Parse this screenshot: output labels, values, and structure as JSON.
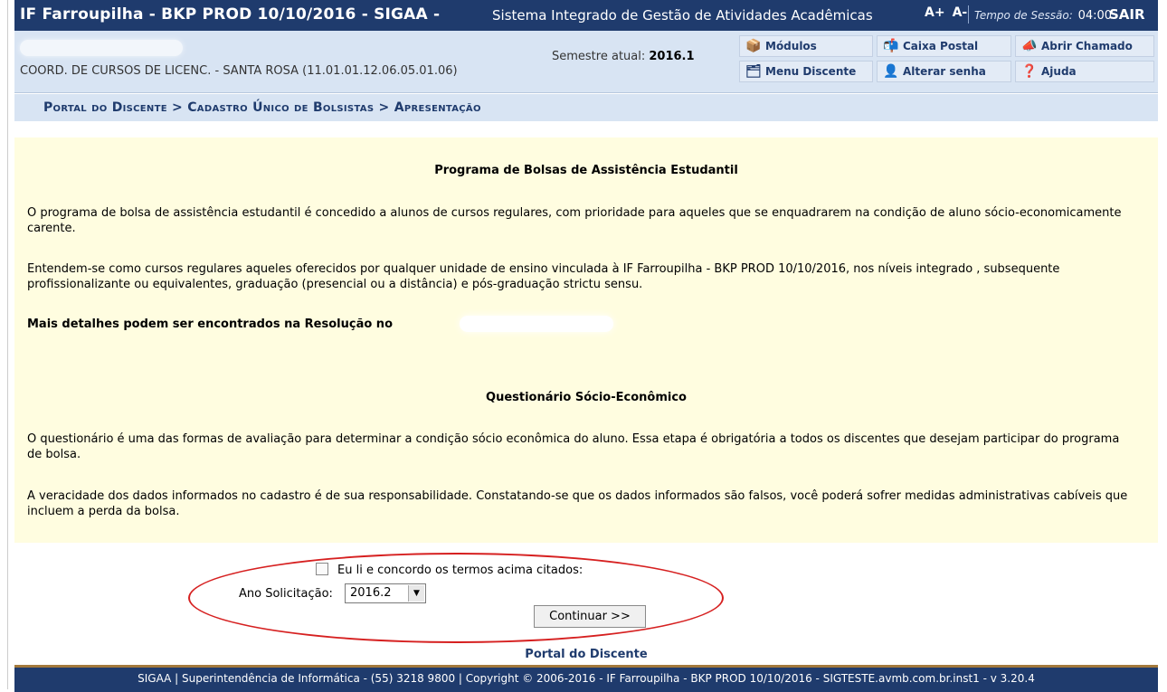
{
  "header": {
    "title": "IF Farroupilha - BKP PROD 10/10/2016 - SIGAA -",
    "subtitle": "Sistema Integrado de Gestão de Atividades Acadêmicas",
    "font_increase": "A+",
    "font_decrease": "A-",
    "session_label": "Tempo de Sessão:",
    "session_time": "04:00",
    "logout": "SAIR"
  },
  "info": {
    "unit": "COORD. DE CURSOS DE LICENC. - SANTA ROSA (11.01.01.12.06.05.01.06)",
    "semester_label": "Semestre atual:",
    "semester_value": "2016.1"
  },
  "menu": {
    "modulos": "Módulos",
    "caixa_postal": "Caixa Postal",
    "abrir_chamado": "Abrir Chamado",
    "menu_discente": "Menu Discente",
    "alterar_senha": "Alterar senha",
    "ajuda": "Ajuda"
  },
  "breadcrumb": "Portal do Discente > Cadastro Único de Bolsistas > Apresentação",
  "content": {
    "heading1": "Programa de Bolsas de Assistência Estudantil",
    "p1": "O programa de bolsa de assistência estudantil é concedido a alunos de cursos regulares, com prioridade para aqueles que se enquadrarem na condição de aluno sócio-economicamente carente.",
    "p2": "Entendem-se como cursos regulares aqueles oferecidos por qualquer unidade de ensino vinculada à IF Farroupilha - BKP PROD 10/10/2016, nos níveis integrado , subsequente profissionalizante ou equivalentes, graduação (presencial ou a distância) e pós-graduação strictu sensu.",
    "details": "Mais detalhes podem ser encontrados na Resolução no",
    "heading2": "Questionário Sócio-Econômico",
    "p3": "O questionário é uma das formas de avaliação para determinar a condição sócio econômica do aluno. Essa etapa é obrigatória a todos os discentes que desejam participar do programa de bolsa.",
    "p4": "A veracidade dos dados informados no cadastro é de sua responsabilidade. Constatando-se que os dados informados são falsos, você poderá sofrer medidas administrativas cabíveis que incluem a perda da bolsa."
  },
  "form": {
    "agree_label": "Eu li e concordo os termos acima citados:",
    "agree_checked": false,
    "year_label": "Ano Solicitação:",
    "year_value": "2016.2",
    "continue_button": "Continuar >>"
  },
  "portal_link": "Portal do Discente",
  "footer": "SIGAA | Superintendência de Informática - (55) 3218 9800 | Copyright © 2006-2016 - IF Farroupilha - BKP PROD 10/10/2016 - SIGTESTE.avmb.com.br.inst1 - v 3.20.4"
}
